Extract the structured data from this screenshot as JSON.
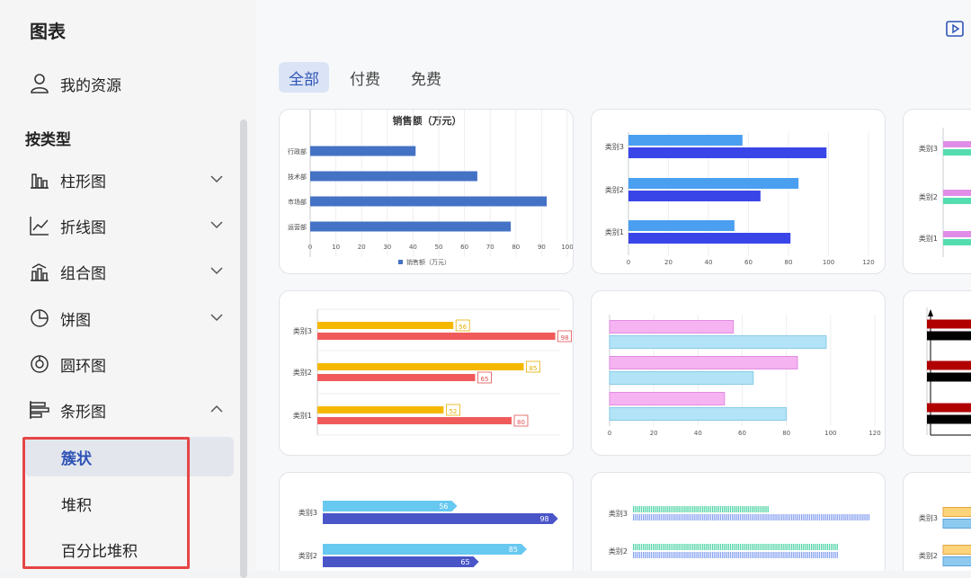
{
  "sidebar": {
    "title": "图表",
    "my_resources": "我的资源",
    "group_title": "按类型",
    "items": [
      {
        "label": "柱形图",
        "icon": "column-chart-icon",
        "expanded": false
      },
      {
        "label": "折线图",
        "icon": "line-chart-icon",
        "expanded": false
      },
      {
        "label": "组合图",
        "icon": "combo-chart-icon",
        "expanded": false
      },
      {
        "label": "饼图",
        "icon": "pie-chart-icon",
        "expanded": false
      },
      {
        "label": "圆环图",
        "icon": "donut-chart-icon"
      },
      {
        "label": "条形图",
        "icon": "bar-chart-icon",
        "expanded": true
      }
    ],
    "subitems": [
      {
        "label": "簇状",
        "active": true
      },
      {
        "label": "堆积",
        "active": false
      },
      {
        "label": "百分比堆积",
        "active": false
      }
    ]
  },
  "tabs": [
    {
      "label": "全部",
      "active": true
    },
    {
      "label": "付费",
      "active": false
    },
    {
      "label": "免费",
      "active": false
    }
  ],
  "colors": {
    "accent": "#2f54b6",
    "highlight_box": "#e64545"
  },
  "chart_data": [
    {
      "type": "bar",
      "title": "销售额（万元）",
      "categories": [
        "行政部",
        "技术部",
        "市场部",
        "运营部"
      ],
      "series": [
        {
          "name": "销售额（万元）",
          "values": [
            41,
            65,
            92,
            78
          ]
        }
      ],
      "xlim": [
        0,
        100
      ],
      "xticks": [
        "0",
        "10",
        "20",
        "30",
        "40",
        "50",
        "60",
        "70",
        "80",
        "90",
        "100"
      ],
      "legend": "bottom"
    },
    {
      "type": "bar",
      "categories": [
        "类别3",
        "类别2",
        "类别1"
      ],
      "series": [
        {
          "values": [
            57,
            85,
            53
          ]
        },
        {
          "values": [
            99,
            66,
            81
          ]
        }
      ],
      "xlim": [
        0,
        120
      ],
      "xticks": [
        "0",
        "20",
        "40",
        "60",
        "80",
        "100",
        "120"
      ]
    },
    {
      "type": "bar",
      "categories": [
        "类别3",
        "类别2",
        "类别1"
      ],
      "series": [
        {
          "values": [
            60,
            60,
            60
          ]
        },
        {
          "values": [
            60,
            60,
            60
          ]
        }
      ]
    },
    {
      "type": "bar",
      "categories": [
        "类别3",
        "类别2",
        "类别1"
      ],
      "series": [
        {
          "values": [
            56,
            85,
            52
          ]
        },
        {
          "values": [
            98,
            65,
            80
          ]
        }
      ],
      "xlim": [
        0,
        100
      ],
      "data_labels": true
    },
    {
      "type": "bar",
      "series": [
        {
          "values": [
            56,
            85,
            52
          ]
        },
        {
          "values": [
            98,
            65,
            80
          ]
        }
      ],
      "xlim": [
        0,
        120
      ],
      "xticks": [
        "0",
        "20",
        "40",
        "60",
        "80",
        "100",
        "120"
      ]
    },
    {
      "type": "bar",
      "series": [
        {
          "values": [
            60,
            60,
            60
          ]
        },
        {
          "values": [
            60,
            60,
            60
          ]
        }
      ]
    },
    {
      "type": "bar",
      "categories": [
        "类别3",
        "类别2"
      ],
      "series": [
        {
          "values": [
            56,
            85
          ]
        },
        {
          "values": [
            98,
            65
          ]
        }
      ],
      "xlim": [
        0,
        100
      ],
      "data_labels": true
    },
    {
      "type": "bar",
      "categories": [
        "类别3",
        "类别2"
      ],
      "series": [
        {
          "values": [
            56,
            85
          ]
        },
        {
          "values": [
            98,
            85
          ]
        }
      ],
      "xlim": [
        0,
        100
      ]
    },
    {
      "type": "bar",
      "categories": [
        "类别3",
        "类别2"
      ],
      "series": [
        {
          "values": [
            60,
            60
          ]
        },
        {
          "values": [
            60,
            60
          ]
        }
      ]
    }
  ]
}
